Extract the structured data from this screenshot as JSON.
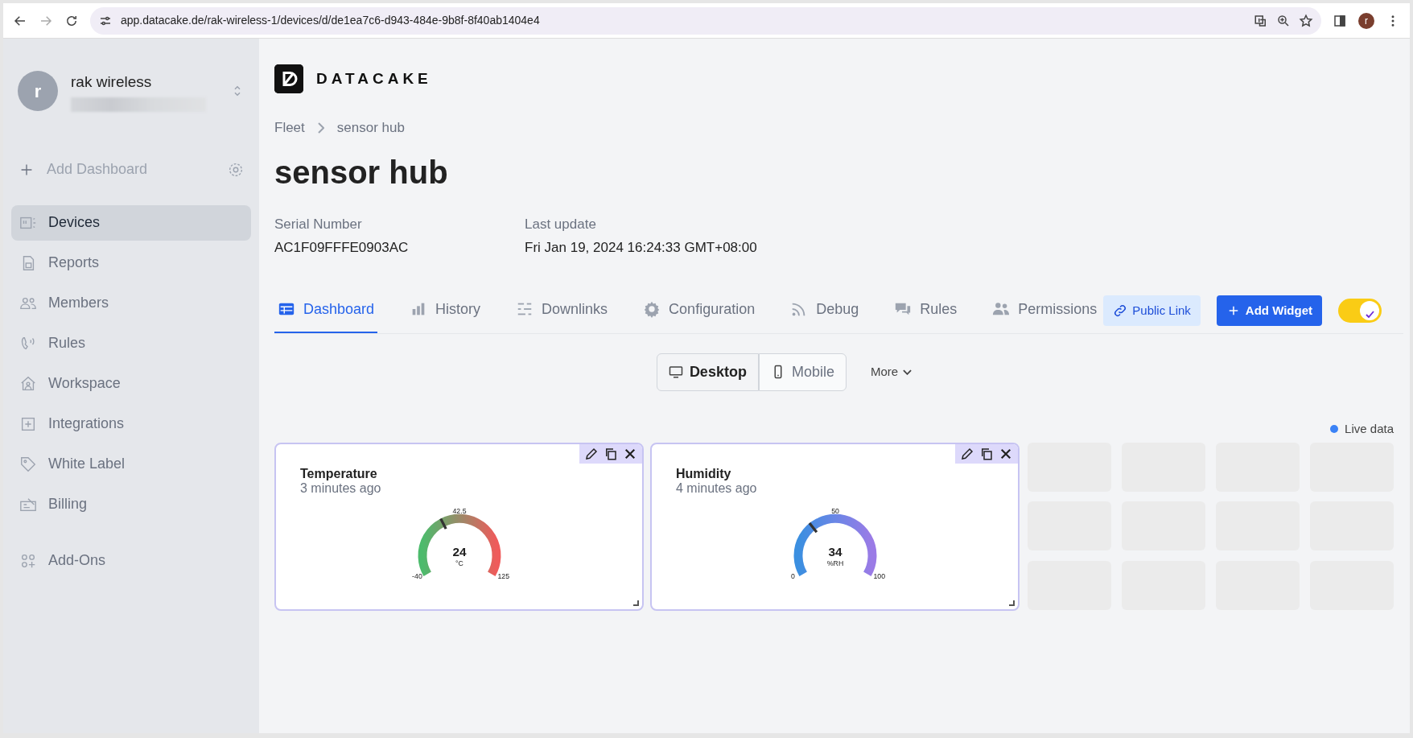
{
  "browser": {
    "url": "app.datacake.de/rak-wireless-1/devices/d/de1ea7c6-d943-484e-9b8f-8f40ab1404e4",
    "profile_initial": "r"
  },
  "sidebar": {
    "workspace": {
      "initial": "r",
      "name": "rak wireless"
    },
    "add_dashboard": "Add Dashboard",
    "items": [
      {
        "label": "Devices",
        "selected": true
      },
      {
        "label": "Reports",
        "selected": false
      },
      {
        "label": "Members",
        "selected": false
      },
      {
        "label": "Rules",
        "selected": false
      },
      {
        "label": "Workspace",
        "selected": false
      },
      {
        "label": "Integrations",
        "selected": false
      },
      {
        "label": "White Label",
        "selected": false
      },
      {
        "label": "Billing",
        "selected": false
      },
      {
        "label": "Add-Ons",
        "selected": false
      }
    ]
  },
  "logo": "DATACAKE",
  "breadcrumb": [
    "Fleet",
    "sensor hub"
  ],
  "title": "sensor hub",
  "info": [
    {
      "label": "Serial Number",
      "value": "AC1F09FFFE0903AC"
    },
    {
      "label": "Last update",
      "value": "Fri Jan 19, 2024 16:24:33 GMT+08:00"
    }
  ],
  "tabs": [
    {
      "label": "Dashboard",
      "selected": true
    },
    {
      "label": "History",
      "selected": false
    },
    {
      "label": "Downlinks",
      "selected": false
    },
    {
      "label": "Configuration",
      "selected": false
    },
    {
      "label": "Debug",
      "selected": false
    },
    {
      "label": "Rules",
      "selected": false
    },
    {
      "label": "Permissions",
      "selected": false
    }
  ],
  "public_link": "Public Link",
  "add_widget": "Add Widget",
  "toggle": {
    "on": true
  },
  "view_switch": [
    {
      "label": "Desktop",
      "selected": true
    },
    {
      "label": "Mobile",
      "selected": false
    }
  ],
  "more": "More",
  "live_data": "Live data",
  "widgets": [
    {
      "title": "Temperature",
      "time": "3 minutes ago",
      "value": "24",
      "unit": "°C",
      "level": 0.388,
      "min": "-40",
      "mid": "42.5",
      "max": "125"
    },
    {
      "title": "Humidity",
      "time": "4 minutes ago",
      "value": "34",
      "unit": "%RH",
      "level": 0.34,
      "min": "0",
      "mid": "50",
      "max": "100"
    }
  ]
}
